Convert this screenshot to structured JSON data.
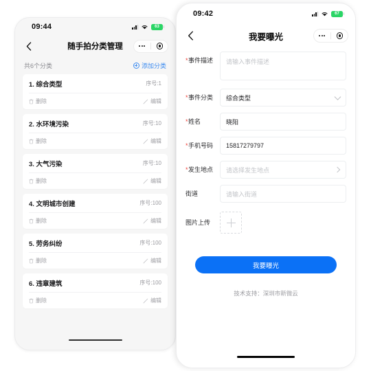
{
  "theme": {
    "accent_blue": "#0b71f6",
    "link_blue": "#3c8bf0",
    "required_red": "#ee3b33",
    "battery_green": "#2bd566",
    "page_bg_left": "#f6f6f6",
    "page_bg_right": "#ffffff"
  },
  "left_phone": {
    "status": {
      "time": "09:44",
      "battery_level": "63",
      "signal_icon": "cellular-signal-icon",
      "wifi_icon": "wifi-icon",
      "battery_icon": "battery-icon"
    },
    "nav": {
      "back_icon": "chevron-left-icon",
      "title": "随手拍分类管理",
      "menu_icon": "more-dots-icon",
      "target_icon": "target-circle-icon"
    },
    "summary": {
      "count_text": "共6个分类",
      "add_label": "添加分类",
      "add_icon": "plus-circle-icon"
    },
    "action_labels": {
      "delete": "删除",
      "edit": "编辑",
      "delete_icon": "trash-icon",
      "edit_icon": "pencil-icon"
    },
    "categories": [
      {
        "name": "1. 综合类型",
        "order": "序号:1"
      },
      {
        "name": "2. 水环境污染",
        "order": "序号:10"
      },
      {
        "name": "3. 大气污染",
        "order": "序号:10"
      },
      {
        "name": "4. 文明城市创建",
        "order": "序号:100"
      },
      {
        "name": "5. 劳务纠纷",
        "order": "序号:100"
      },
      {
        "name": "6. 违章建筑",
        "order": "序号:100"
      }
    ]
  },
  "right_phone": {
    "status": {
      "time": "09:42",
      "battery_level": "67",
      "signal_icon": "cellular-signal-icon",
      "wifi_icon": "wifi-icon",
      "battery_icon": "battery-icon"
    },
    "nav": {
      "back_icon": "chevron-left-icon",
      "title": "我要曝光",
      "menu_icon": "more-dots-icon",
      "target_icon": "target-circle-icon"
    },
    "form": {
      "event_desc": {
        "label": "事件描述",
        "required": true,
        "placeholder": "请输入事件描述",
        "value": ""
      },
      "event_type": {
        "label": "事件分类",
        "required": true,
        "placeholder": "",
        "value": "综合类型"
      },
      "name": {
        "label": "姓名",
        "required": true,
        "placeholder": "",
        "value": "晓阳"
      },
      "phone": {
        "label": "手机号码",
        "required": true,
        "placeholder": "",
        "value": "15817279797"
      },
      "location": {
        "label": "发生地点",
        "required": true,
        "placeholder": "请选择发生地点",
        "value": ""
      },
      "street": {
        "label": "街道",
        "required": false,
        "placeholder": "请输入街道",
        "value": ""
      },
      "image_upload": {
        "label": "图片上传",
        "required": false,
        "add_icon": "plus-icon"
      }
    },
    "submit_label": "我要曝光",
    "footer_note": "技术支持：深圳市新微云"
  }
}
